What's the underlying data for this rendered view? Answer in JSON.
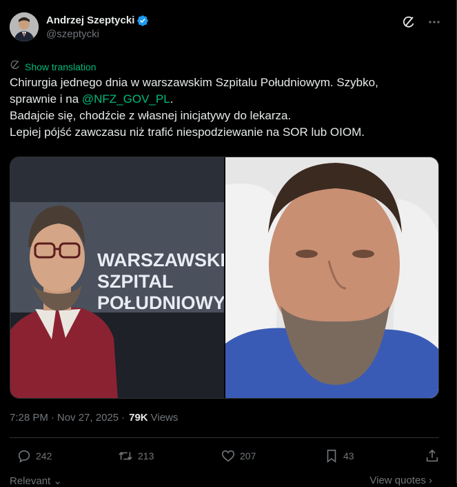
{
  "author": {
    "display_name": "Andrzej Szeptycki",
    "handle": "@szeptycki"
  },
  "translate": {
    "label": "Show translation"
  },
  "tweet": {
    "line1": "Chirurgia jednego dnia w warszawskim Szpitalu Południowym. Szybko,",
    "line2_prefix": "sprawnie i na ",
    "mention": "@NFZ_GOV_PL",
    "line2_suffix": ".",
    "line3": "Badajcie się, chodźcie z własnej inicjatywy do lekarza.",
    "line4": "Lepiej pójść zawczasu niż trafić niespodziewanie na SOR lub OIOM."
  },
  "media": {
    "sign_line1": "WARSZAWSKI",
    "sign_line2": "SZPITAL",
    "sign_line3": "POŁUDNIOWY"
  },
  "meta": {
    "time": "7:28 PM",
    "separator": "·",
    "date": "Nov 27, 2025",
    "views_count": "79K",
    "views_label": "Views"
  },
  "actions": {
    "replies": "242",
    "reposts": "213",
    "likes": "207",
    "bookmarks": "43"
  },
  "footer": {
    "relevant": "Relevant",
    "view_quotes": "View quotes"
  },
  "colors": {
    "accent_green": "#00ba7c",
    "verified_blue": "#1d9bf0",
    "muted": "#71767b",
    "text": "#e7e9ea",
    "background": "#000000"
  },
  "icons": [
    "verified-badge-icon",
    "grok-icon",
    "more-icon",
    "translate-icon",
    "reply-icon",
    "repost-icon",
    "like-icon",
    "bookmark-icon",
    "share-icon",
    "chevron-down-icon",
    "chevron-right-icon"
  ]
}
